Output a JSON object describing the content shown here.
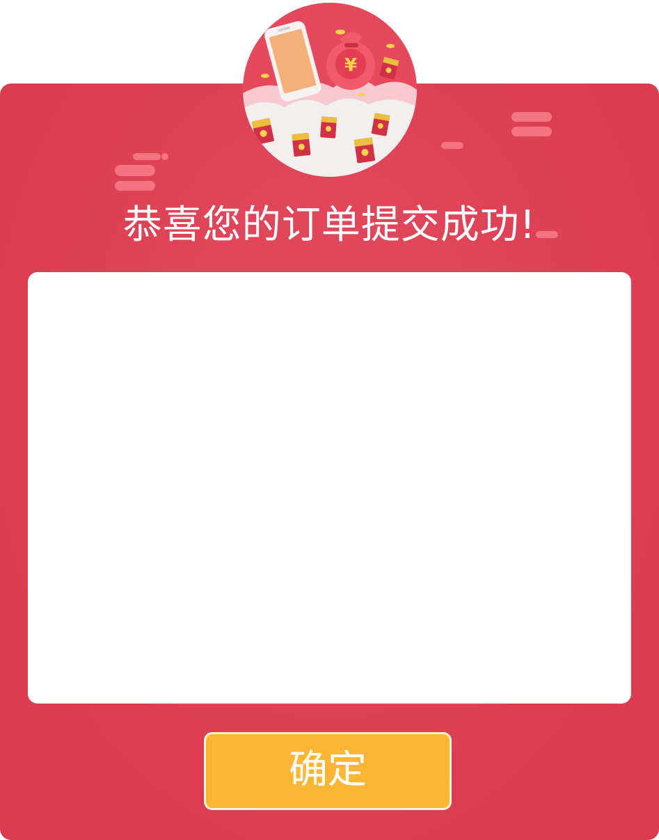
{
  "dialog": {
    "title": "恭喜您的订单提交成功!",
    "confirm_label": "确定"
  },
  "illustration": {
    "icons": [
      "phone-icon",
      "money-bag-icon",
      "red-envelope-icon",
      "coin-icon",
      "cloud-icon"
    ],
    "money_symbol": "¥"
  },
  "colors": {
    "modal_bg": "#dd3d52",
    "button_bg": "#fdb634",
    "decoration": "#f47484",
    "content_bg": "#ffffff"
  }
}
